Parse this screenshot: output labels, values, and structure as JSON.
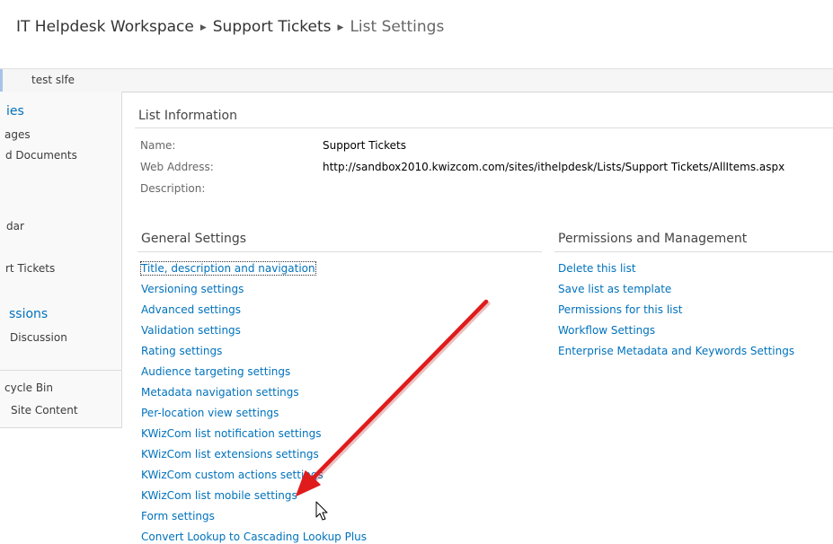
{
  "breadcrumb": {
    "site": "IT Helpdesk Workspace",
    "list": "Support Tickets",
    "current": "List Settings",
    "separator": "▶"
  },
  "top_nav": {
    "tab": "test slfe"
  },
  "quick_launch": {
    "items": [
      "ies",
      "ages",
      "d Documents",
      "dar",
      "rt Tickets",
      "ssions",
      "Discussion",
      "cycle Bin",
      "Site Content"
    ]
  },
  "list_info": {
    "title": "List Information",
    "name_label": "Name:",
    "name_value": "Support Tickets",
    "address_label": "Web Address:",
    "address_value": "http://sandbox2010.kwizcom.com/sites/ithelpdesk/Lists/Support Tickets/AllItems.aspx",
    "description_label": "Description:"
  },
  "general_settings": {
    "title": "General Settings",
    "links": [
      "Title, description and navigation",
      "Versioning settings",
      "Advanced settings",
      "Validation settings",
      "Rating settings",
      "Audience targeting settings",
      "Metadata navigation settings",
      "Per-location view settings",
      "KWizCom list notification settings",
      "KWizCom list extensions settings",
      "KWizCom custom actions settings",
      "KWizCom list mobile settings",
      "Form settings",
      "Convert Lookup to Cascading Lookup Plus"
    ]
  },
  "permissions": {
    "title": "Permissions and Management",
    "links": [
      "Delete this list",
      "Save list as template",
      "Permissions for this list",
      "Workflow Settings",
      "Enterprise Metadata and Keywords Settings"
    ]
  },
  "colors": {
    "link": "#0072bc",
    "annotation_arrow": "#e01b1b",
    "label": "#676767"
  },
  "icons": {
    "annotation": "red-arrow-icon",
    "cursor": "mouse-pointer-icon"
  }
}
